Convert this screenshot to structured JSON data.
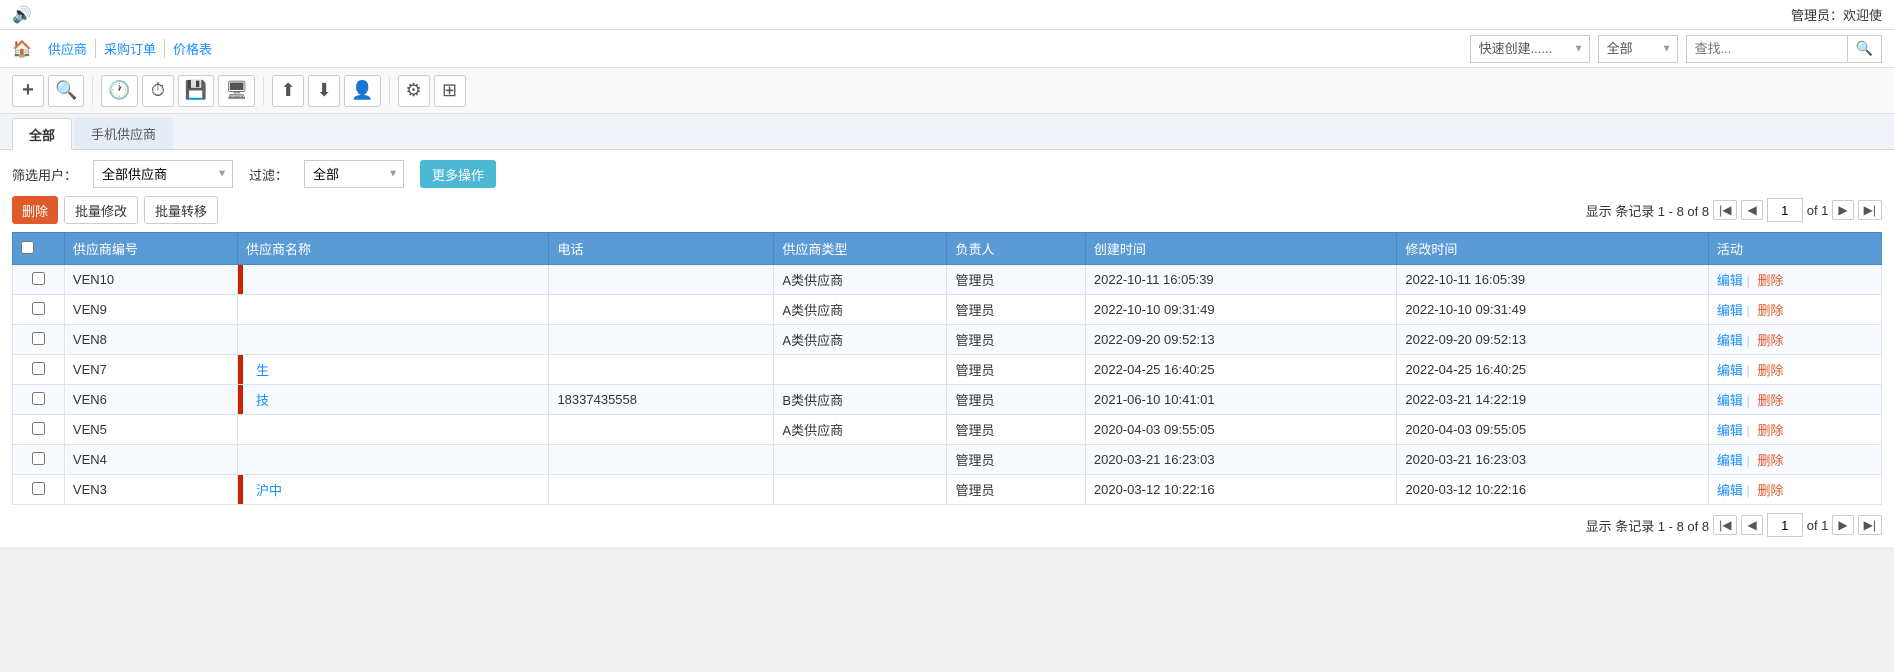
{
  "topbar": {
    "admin_text": "管理员：欢迎使"
  },
  "navbar": {
    "home_icon": "🏠",
    "links": [
      "供应商",
      "采购订单",
      "价格表"
    ],
    "quick_create_placeholder": "快速创建......",
    "filter_default": "全部",
    "search_placeholder": "查找..."
  },
  "toolbar": {
    "buttons": [
      {
        "name": "add",
        "icon": "+"
      },
      {
        "name": "search",
        "icon": "🔍"
      },
      {
        "name": "clock1",
        "icon": "🕐"
      },
      {
        "name": "clock2",
        "icon": "⏱"
      },
      {
        "name": "save",
        "icon": "💾"
      },
      {
        "name": "monitor",
        "icon": "🖥"
      },
      {
        "name": "export1",
        "icon": "⬆"
      },
      {
        "name": "export2",
        "icon": "⬇"
      },
      {
        "name": "user",
        "icon": "👤"
      },
      {
        "name": "gear",
        "icon": "⚙"
      },
      {
        "name": "grid",
        "icon": "⊞"
      }
    ]
  },
  "tabs": [
    {
      "label": "全部",
      "active": true
    },
    {
      "label": "手机供应商",
      "active": false
    }
  ],
  "filter": {
    "user_label": "筛选用户：",
    "user_options": [
      "全部供应商"
    ],
    "user_selected": "全部供应商",
    "filter_label": "过滤：",
    "filter_options": [
      "全部"
    ],
    "filter_selected": "全部",
    "more_btn": "更多操作"
  },
  "actions": {
    "delete_btn": "删除",
    "batch_edit_btn": "批量修改",
    "batch_transfer_btn": "批量转移"
  },
  "pagination": {
    "summary": "显示 条记录 1 - 8 of 8",
    "current_page": "1",
    "total_pages": "of 1"
  },
  "table": {
    "headers": [
      "",
      "供应商编号",
      "供应商名称",
      "电话",
      "供应商类型",
      "负责人",
      "创建时间",
      "修改时间",
      "活动"
    ],
    "rows": [
      {
        "id": "VEN10",
        "name": "",
        "name_has_bar": true,
        "phone": "",
        "type": "A类供应商",
        "owner": "管理员",
        "created": "2022-10-11 16:05:39",
        "modified": "2022-10-11 16:05:39",
        "edit_label": "编辑",
        "delete_label": "删除"
      },
      {
        "id": "VEN9",
        "name": "",
        "name_has_bar": false,
        "phone": "",
        "type": "A类供应商",
        "owner": "管理员",
        "created": "2022-10-10 09:31:49",
        "modified": "2022-10-10 09:31:49",
        "edit_label": "编辑",
        "delete_label": "删除"
      },
      {
        "id": "VEN8",
        "name": "",
        "name_has_bar": false,
        "phone": "",
        "type": "A类供应商",
        "owner": "管理员",
        "created": "2022-09-20 09:52:13",
        "modified": "2022-09-20 09:52:13",
        "edit_label": "编辑",
        "delete_label": "删除"
      },
      {
        "id": "VEN7",
        "name": "生",
        "name_has_bar": true,
        "phone": "",
        "type": "",
        "owner": "管理员",
        "created": "2022-04-25 16:40:25",
        "modified": "2022-04-25 16:40:25",
        "edit_label": "编辑",
        "delete_label": "删除"
      },
      {
        "id": "VEN6",
        "name": "技",
        "name_has_bar": true,
        "phone": "18337435558",
        "type": "B类供应商",
        "owner": "管理员",
        "created": "2021-06-10 10:41:01",
        "modified": "2022-03-21 14:22:19",
        "edit_label": "编辑",
        "delete_label": "删除"
      },
      {
        "id": "VEN5",
        "name": "",
        "name_has_bar": false,
        "phone": "",
        "type": "A类供应商",
        "owner": "管理员",
        "created": "2020-04-03 09:55:05",
        "modified": "2020-04-03 09:55:05",
        "edit_label": "编辑",
        "delete_label": "删除"
      },
      {
        "id": "VEN4",
        "name": "",
        "name_has_bar": false,
        "phone": "",
        "type": "",
        "owner": "管理员",
        "created": "2020-03-21 16:23:03",
        "modified": "2020-03-21 16:23:03",
        "edit_label": "编辑",
        "delete_label": "删除"
      },
      {
        "id": "VEN3",
        "name": "沪中",
        "name_has_bar": true,
        "phone": "",
        "type": "",
        "owner": "管理员",
        "created": "2020-03-12 10:22:16",
        "modified": "2020-03-12 10:22:16",
        "edit_label": "编辑",
        "delete_label": "删除"
      }
    ]
  },
  "pagination_bottom": {
    "summary": "显示 条记录 1 - 8 of 8",
    "current_page": "1",
    "total_pages": "of 1"
  }
}
